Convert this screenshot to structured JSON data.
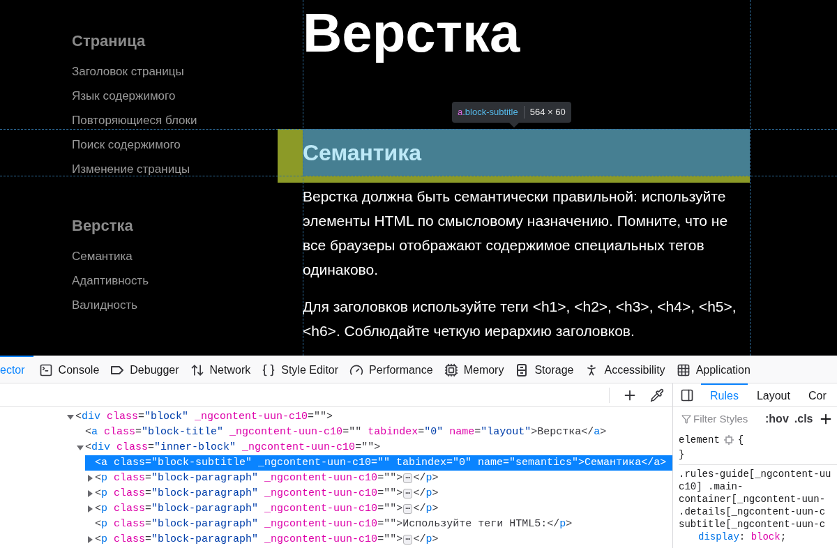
{
  "page": {
    "sidebar": [
      {
        "heading": "Страница",
        "items": [
          "Заголовок страницы",
          "Язык содержимого",
          "Повторяющиеся блоки",
          "Поиск содержимого",
          "Изменение страницы"
        ]
      },
      {
        "heading": "Верстка",
        "items": [
          "Семантика",
          "Адаптивность",
          "Валидность"
        ]
      }
    ],
    "title": "Верстка",
    "tooltip": {
      "tag": "a",
      "class": ".block-subtitle",
      "size": "564 × 60"
    },
    "subtitle": "Семантика",
    "paragraphs": [
      "Верстка должна быть семантически правильной: используйте элементы HTML по смысловому назначению. Помните, что не все браузеры отображают содержимое специальных тегов одинаково.",
      "Для заголовков используйте теги <h1>, <h2>, <h3>, <h4>, <h5>, <h6>. Соблюдайте четкую иерархию заголовков."
    ]
  },
  "devtools": {
    "tabs": [
      {
        "kind": "inspector",
        "label": "ector",
        "selected": true
      },
      {
        "kind": "console",
        "label": "Console",
        "selected": false
      },
      {
        "kind": "debugger",
        "label": "Debugger",
        "selected": false
      },
      {
        "kind": "network",
        "label": "Network",
        "selected": false
      },
      {
        "kind": "style",
        "label": "Style Editor",
        "selected": false
      },
      {
        "kind": "performance",
        "label": "Performance",
        "selected": false
      },
      {
        "kind": "memory",
        "label": "Memory",
        "selected": false
      },
      {
        "kind": "storage",
        "label": "Storage",
        "selected": false
      },
      {
        "kind": "accessibility",
        "label": "Accessibility",
        "selected": false
      },
      {
        "kind": "application",
        "label": "Application",
        "selected": false
      }
    ],
    "markup": [
      {
        "expanded": true,
        "selected": false,
        "tokens": [
          {
            "kind": "punct",
            "text": "<"
          },
          {
            "kind": "tag",
            "text": "div"
          },
          {
            "kind": "attr",
            "text": " class"
          },
          {
            "kind": "punct",
            "text": "="
          },
          {
            "kind": "value",
            "text": "\"block\""
          },
          {
            "kind": "attr",
            "text": " _ngcontent-uun-c10"
          },
          {
            "kind": "punct",
            "text": "=\"\">"
          }
        ],
        "children": [
          {
            "selected": false,
            "tokens": [
              {
                "kind": "punct",
                "text": "<"
              },
              {
                "kind": "tag",
                "text": "a"
              },
              {
                "kind": "attr",
                "text": " class"
              },
              {
                "kind": "punct",
                "text": "="
              },
              {
                "kind": "value",
                "text": "\"block-title\""
              },
              {
                "kind": "attr",
                "text": " _ngcontent-uun-c10"
              },
              {
                "kind": "punct",
                "text": "=\"\""
              },
              {
                "kind": "attr",
                "text": " tabindex"
              },
              {
                "kind": "punct",
                "text": "="
              },
              {
                "kind": "value",
                "text": "\"0\""
              },
              {
                "kind": "attr",
                "text": " name"
              },
              {
                "kind": "punct",
                "text": "="
              },
              {
                "kind": "value",
                "text": "\"layout\""
              },
              {
                "kind": "punct",
                "text": ">"
              },
              {
                "kind": "text",
                "text": "Верстка"
              },
              {
                "kind": "punct",
                "text": "</"
              },
              {
                "kind": "tag",
                "text": "a"
              },
              {
                "kind": "punct",
                "text": ">"
              }
            ]
          },
          {
            "expanded": true,
            "selected": false,
            "tokens": [
              {
                "kind": "punct",
                "text": "<"
              },
              {
                "kind": "tag",
                "text": "div"
              },
              {
                "kind": "attr",
                "text": " class"
              },
              {
                "kind": "punct",
                "text": "="
              },
              {
                "kind": "value",
                "text": "\"inner-block\""
              },
              {
                "kind": "attr",
                "text": " _ngcontent-uun-c10"
              },
              {
                "kind": "punct",
                "text": "=\"\">"
              }
            ],
            "children": [
              {
                "selected": true,
                "text": "<a class=\"block-subtitle\" _ngcontent-uun-c10=\"\" tabindex=\"0\" name=\"semantics\">Семантика</a>"
              },
              {
                "expanded": false,
                "selected": false,
                "tokens": [
                  {
                    "kind": "punct",
                    "text": "<"
                  },
                  {
                    "kind": "tag",
                    "text": "p"
                  },
                  {
                    "kind": "attr",
                    "text": " class"
                  },
                  {
                    "kind": "punct",
                    "text": "="
                  },
                  {
                    "kind": "value",
                    "text": "\"block-paragraph\""
                  },
                  {
                    "kind": "attr",
                    "text": " _ngcontent-uun-c10"
                  },
                  {
                    "kind": "punct",
                    "text": "=\"\">"
                  }
                ],
                "badge": "⋯",
                "tail": [
                  {
                    "kind": "punct",
                    "text": "</"
                  },
                  {
                    "kind": "tag",
                    "text": "p"
                  },
                  {
                    "kind": "punct",
                    "text": ">"
                  }
                ]
              },
              {
                "expanded": false,
                "selected": false,
                "tokens": [
                  {
                    "kind": "punct",
                    "text": "<"
                  },
                  {
                    "kind": "tag",
                    "text": "p"
                  },
                  {
                    "kind": "attr",
                    "text": " class"
                  },
                  {
                    "kind": "punct",
                    "text": "="
                  },
                  {
                    "kind": "value",
                    "text": "\"block-paragraph\""
                  },
                  {
                    "kind": "attr",
                    "text": " _ngcontent-uun-c10"
                  },
                  {
                    "kind": "punct",
                    "text": "=\"\">"
                  }
                ],
                "badge": "⋯",
                "tail": [
                  {
                    "kind": "punct",
                    "text": "</"
                  },
                  {
                    "kind": "tag",
                    "text": "p"
                  },
                  {
                    "kind": "punct",
                    "text": ">"
                  }
                ]
              },
              {
                "expanded": false,
                "selected": false,
                "tokens": [
                  {
                    "kind": "punct",
                    "text": "<"
                  },
                  {
                    "kind": "tag",
                    "text": "p"
                  },
                  {
                    "kind": "attr",
                    "text": " class"
                  },
                  {
                    "kind": "punct",
                    "text": "="
                  },
                  {
                    "kind": "value",
                    "text": "\"block-paragraph\""
                  },
                  {
                    "kind": "attr",
                    "text": " _ngcontent-uun-c10"
                  },
                  {
                    "kind": "punct",
                    "text": "=\"\">"
                  }
                ],
                "badge": "⋯",
                "tail": [
                  {
                    "kind": "punct",
                    "text": "</"
                  },
                  {
                    "kind": "tag",
                    "text": "p"
                  },
                  {
                    "kind": "punct",
                    "text": ">"
                  }
                ]
              },
              {
                "selected": false,
                "tokens": [
                  {
                    "kind": "punct",
                    "text": "<"
                  },
                  {
                    "kind": "tag",
                    "text": "p"
                  },
                  {
                    "kind": "attr",
                    "text": " class"
                  },
                  {
                    "kind": "punct",
                    "text": "="
                  },
                  {
                    "kind": "value",
                    "text": "\"block-paragraph\""
                  },
                  {
                    "kind": "attr",
                    "text": " _ngcontent-uun-c10"
                  },
                  {
                    "kind": "punct",
                    "text": "=\"\">"
                  },
                  {
                    "kind": "text",
                    "text": "Используйте теги HTML5:"
                  },
                  {
                    "kind": "punct",
                    "text": "</"
                  },
                  {
                    "kind": "tag",
                    "text": "p"
                  },
                  {
                    "kind": "punct",
                    "text": ">"
                  }
                ]
              },
              {
                "expanded": false,
                "selected": false,
                "tokens": [
                  {
                    "kind": "punct",
                    "text": "<"
                  },
                  {
                    "kind": "tag",
                    "text": "p"
                  },
                  {
                    "kind": "attr",
                    "text": " class"
                  },
                  {
                    "kind": "punct",
                    "text": "="
                  },
                  {
                    "kind": "value",
                    "text": "\"block-paragraph\""
                  },
                  {
                    "kind": "attr",
                    "text": " _ngcontent-uun-c10"
                  },
                  {
                    "kind": "punct",
                    "text": "=\"\">"
                  }
                ],
                "badge": "⋯",
                "tail": [
                  {
                    "kind": "punct",
                    "text": "</"
                  },
                  {
                    "kind": "tag",
                    "text": "p"
                  },
                  {
                    "kind": "punct",
                    "text": ">"
                  }
                ]
              }
            ]
          }
        ]
      }
    ],
    "sidebar_tabs": [
      {
        "label": "Rules",
        "selected": true
      },
      {
        "label": "Layout",
        "selected": false
      },
      {
        "label": "Cor",
        "selected": false
      }
    ],
    "filter_placeholder": "Filter Styles",
    "filter_buttons": [
      ":hov",
      ".cls"
    ],
    "rules": {
      "element": "element",
      "open": "{",
      "close": "}",
      "selector_lines": [
        ".rules-guide[_ngcontent-uu",
        "c10] .main-",
        "container[_ngcontent-uun-",
        ".details[_ngcontent-uun-c",
        "subtitle[_ngcontent-uun-c"
      ],
      "declarations": [
        {
          "property": "display",
          "separator": ":",
          "value": "block",
          "terminator": ";"
        }
      ]
    }
  }
}
